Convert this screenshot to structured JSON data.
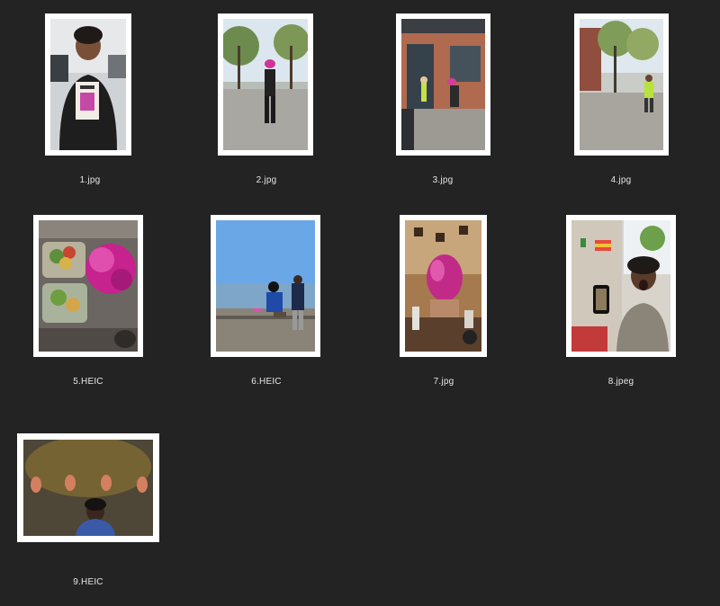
{
  "window": {
    "view": "icon-grid"
  },
  "colors": {
    "background": "#232323",
    "label": "#e6e6e6",
    "frame": "#ffffff"
  },
  "files": [
    {
      "name": "1.jpg",
      "icon": "portrait-woman-holding-card-photo"
    },
    {
      "name": "2.jpg",
      "icon": "street-walking-photo"
    },
    {
      "name": "3.jpg",
      "icon": "building-entrance-photo"
    },
    {
      "name": "4.jpg",
      "icon": "child-running-street-photo"
    },
    {
      "name": "5.HEIC",
      "icon": "salad-and-tinsel-photo"
    },
    {
      "name": "6.HEIC",
      "icon": "waterfront-people-photo"
    },
    {
      "name": "7.jpg",
      "icon": "pink-wig-photo"
    },
    {
      "name": "8.jpeg",
      "icon": "woman-with-phone-photo"
    },
    {
      "name": "9.HEIC",
      "icon": "masks-on-wall-photo"
    }
  ]
}
